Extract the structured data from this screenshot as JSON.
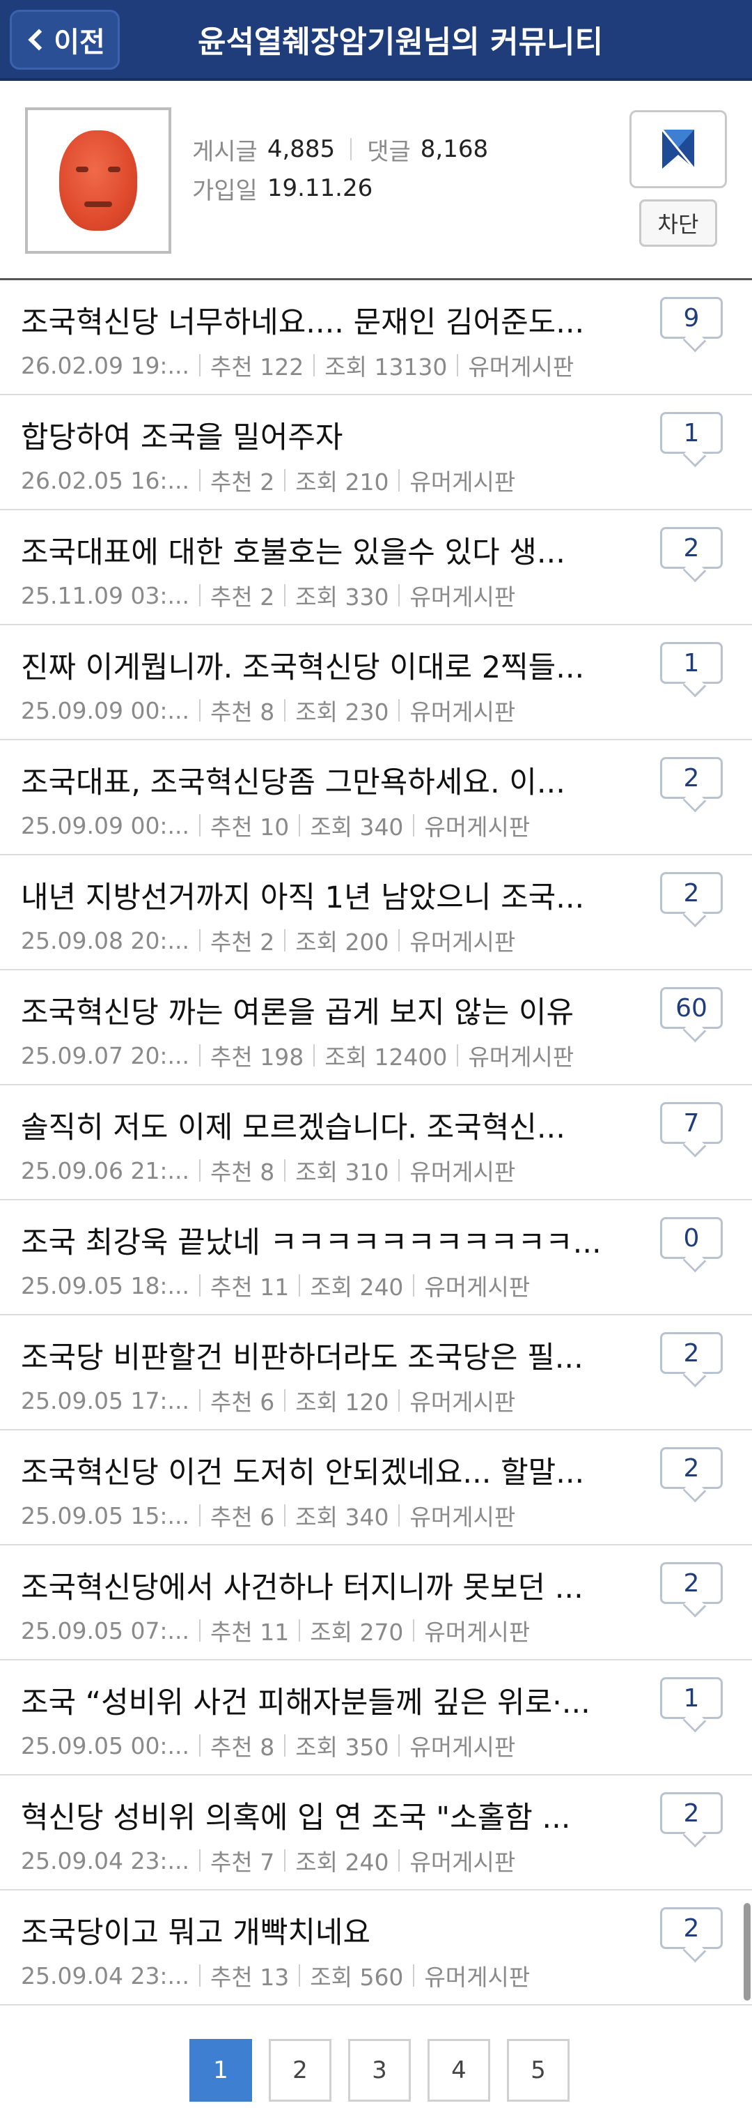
{
  "header": {
    "back_label": "이전",
    "title": "윤석열췌장암기원님의 커뮤니티"
  },
  "profile": {
    "posts_label": "게시글",
    "posts_count": "4,885",
    "comments_label": "댓글",
    "comments_count": "8,168",
    "joined_label": "가입일",
    "joined_date": "19.11.26",
    "block_label": "차단"
  },
  "posts": [
    {
      "title": "조국혁신당 너무하네요.... 문재인 김어준도...",
      "date": "26.02.09  19:...",
      "recommend": "추천 122",
      "views": "조회 13130",
      "board": "유머게시판",
      "comments": "9"
    },
    {
      "title": "합당하여 조국을 밀어주자",
      "date": "26.02.05  16:...",
      "recommend": "추천 2",
      "views": "조회 210",
      "board": "유머게시판",
      "comments": "1"
    },
    {
      "title": "조국대표에 대한 호불호는 있을수 있다 생...",
      "date": "25.11.09  03:...",
      "recommend": "추천 2",
      "views": "조회 330",
      "board": "유머게시판",
      "comments": "2"
    },
    {
      "title": "진짜 이게뭡니까. 조국혁신당 이대로 2찍들...",
      "date": "25.09.09  00:...",
      "recommend": "추천 8",
      "views": "조회 230",
      "board": "유머게시판",
      "comments": "1"
    },
    {
      "title": "조국대표, 조국혁신당좀 그만욕하세요. 이...",
      "date": "25.09.09  00:...",
      "recommend": "추천 10",
      "views": "조회 340",
      "board": "유머게시판",
      "comments": "2"
    },
    {
      "title": "내년 지방선거까지 아직 1년 남았으니 조국...",
      "date": "25.09.08  20:...",
      "recommend": "추천 2",
      "views": "조회 200",
      "board": "유머게시판",
      "comments": "2"
    },
    {
      "title": "조국혁신당 까는 여론을 곱게 보지 않는 이유",
      "date": "25.09.07  20:...",
      "recommend": "추천 198",
      "views": "조회 12400",
      "board": "유머게시판",
      "comments": "60"
    },
    {
      "title": "솔직히 저도 이제 모르겠습니다. 조국혁신...",
      "date": "25.09.06  21:...",
      "recommend": "추천 8",
      "views": "조회 310",
      "board": "유머게시판",
      "comments": "7"
    },
    {
      "title": "조국 최강욱 끝났네 ㅋㅋㅋㅋㅋㅋㅋㅋㅋㅋㅋ...",
      "date": "25.09.05  18:...",
      "recommend": "추천 11",
      "views": "조회 240",
      "board": "유머게시판",
      "comments": "0"
    },
    {
      "title": "조국당 비판할건 비판하더라도 조국당은 필...",
      "date": "25.09.05  17:...",
      "recommend": "추천 6",
      "views": "조회 120",
      "board": "유머게시판",
      "comments": "2"
    },
    {
      "title": "조국혁신당 이건 도저히 안되겠네요... 할말...",
      "date": "25.09.05  15:...",
      "recommend": "추천 6",
      "views": "조회 340",
      "board": "유머게시판",
      "comments": "2"
    },
    {
      "title": "조국혁신당에서 사건하나 터지니까 못보던 ...",
      "date": "25.09.05  07:...",
      "recommend": "추천 11",
      "views": "조회 270",
      "board": "유머게시판",
      "comments": "2"
    },
    {
      "title": "조국 “성비위 사건 피해자분들께 깊은 위로·...",
      "date": "25.09.05  00:...",
      "recommend": "추천 8",
      "views": "조회 350",
      "board": "유머게시판",
      "comments": "1"
    },
    {
      "title": "혁신당 성비위 의혹에 입 연 조국 \"소홀함 ...",
      "date": "25.09.04  23:...",
      "recommend": "추천 7",
      "views": "조회 240",
      "board": "유머게시판",
      "comments": "2"
    },
    {
      "title": "조국당이고 뭐고 개빡치네요",
      "date": "25.09.04  23:...",
      "recommend": "추천 13",
      "views": "조회 560",
      "board": "유머게시판",
      "comments": "2"
    }
  ],
  "pagination": {
    "pages": [
      "1",
      "2",
      "3",
      "4",
      "5"
    ],
    "current": "1"
  },
  "colors": {
    "header_bg": "#1f3d7a",
    "active_page": "#3f7fd1"
  }
}
